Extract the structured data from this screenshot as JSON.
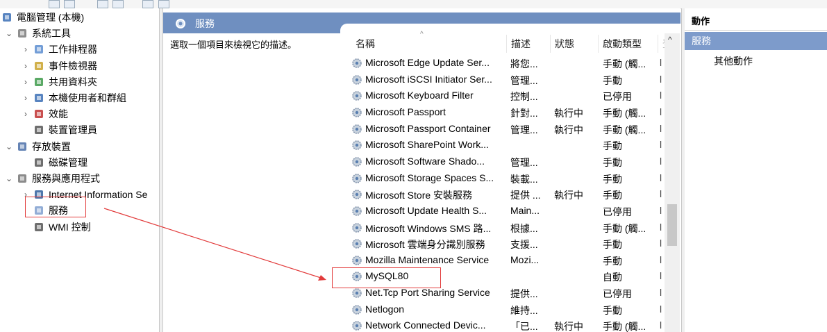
{
  "app": {
    "title": "電腦管理 (本機)"
  },
  "tree": {
    "items": [
      {
        "label": "電腦管理 (本機)",
        "indent": 0,
        "chevron": "",
        "icon": "computer-icon"
      },
      {
        "label": "系統工具",
        "indent": 1,
        "chevron": "⌄",
        "icon": "tools-icon"
      },
      {
        "label": "工作排程器",
        "indent": 2,
        "chevron": "›",
        "icon": "clock-icon"
      },
      {
        "label": "事件檢視器",
        "indent": 2,
        "chevron": "›",
        "icon": "event-viewer-icon"
      },
      {
        "label": "共用資料夾",
        "indent": 2,
        "chevron": "›",
        "icon": "shared-folder-icon"
      },
      {
        "label": "本機使用者和群組",
        "indent": 2,
        "chevron": "›",
        "icon": "users-icon"
      },
      {
        "label": "效能",
        "indent": 2,
        "chevron": "›",
        "icon": "performance-icon"
      },
      {
        "label": "裝置管理員",
        "indent": 2,
        "chevron": "",
        "icon": "device-manager-icon"
      },
      {
        "label": "存放裝置",
        "indent": 1,
        "chevron": "⌄",
        "icon": "storage-icon"
      },
      {
        "label": "磁碟管理",
        "indent": 2,
        "chevron": "",
        "icon": "disk-icon"
      },
      {
        "label": "服務與應用程式",
        "indent": 1,
        "chevron": "⌄",
        "icon": "services-apps-icon"
      },
      {
        "label": "Internet Information Se",
        "indent": 2,
        "chevron": "›",
        "icon": "iis-icon"
      },
      {
        "label": "服務",
        "indent": 2,
        "chevron": "",
        "icon": "gear-icon"
      },
      {
        "label": "WMI 控制",
        "indent": 2,
        "chevron": "",
        "icon": "wmi-icon"
      }
    ]
  },
  "center": {
    "header_label": "服務",
    "description": "選取一個項目來檢視它的描述。",
    "columns": [
      "名稱",
      "描述",
      "狀態",
      "啟動類型",
      "登"
    ],
    "rows": [
      {
        "name": "Microsoft Edge Update Ser...",
        "desc": "將您...",
        "status": "",
        "startup": "手動 (觸...",
        "logon": "l"
      },
      {
        "name": "Microsoft iSCSI Initiator Ser...",
        "desc": "管理...",
        "status": "",
        "startup": "手動",
        "logon": "l"
      },
      {
        "name": "Microsoft Keyboard Filter",
        "desc": "控制...",
        "status": "",
        "startup": "已停用",
        "logon": "l"
      },
      {
        "name": "Microsoft Passport",
        "desc": "針對...",
        "status": "執行中",
        "startup": "手動 (觸...",
        "logon": "l"
      },
      {
        "name": "Microsoft Passport Container",
        "desc": "管理...",
        "status": "執行中",
        "startup": "手動 (觸...",
        "logon": "l"
      },
      {
        "name": "Microsoft SharePoint Work...",
        "desc": "",
        "status": "",
        "startup": "手動",
        "logon": "l"
      },
      {
        "name": "Microsoft Software Shado...",
        "desc": "管理...",
        "status": "",
        "startup": "手動",
        "logon": "l"
      },
      {
        "name": "Microsoft Storage Spaces S...",
        "desc": "裝載...",
        "status": "",
        "startup": "手動",
        "logon": "l"
      },
      {
        "name": "Microsoft Store 安裝服務",
        "desc": "提供 ...",
        "status": "執行中",
        "startup": "手動",
        "logon": "l"
      },
      {
        "name": "Microsoft Update Health S...",
        "desc": "Main...",
        "status": "",
        "startup": "已停用",
        "logon": "l"
      },
      {
        "name": "Microsoft Windows SMS 路...",
        "desc": "根據...",
        "status": "",
        "startup": "手動 (觸...",
        "logon": "l"
      },
      {
        "name": "Microsoft 雲端身分識別服務",
        "desc": "支援...",
        "status": "",
        "startup": "手動",
        "logon": "l"
      },
      {
        "name": "Mozilla Maintenance Service",
        "desc": "Mozi...",
        "status": "",
        "startup": "手動",
        "logon": "l"
      },
      {
        "name": "MySQL80",
        "desc": "",
        "status": "",
        "startup": "自動",
        "logon": "l"
      },
      {
        "name": "Net.Tcp Port Sharing Service",
        "desc": "提供...",
        "status": "",
        "startup": "已停用",
        "logon": "l"
      },
      {
        "name": "Netlogon",
        "desc": "維持...",
        "status": "",
        "startup": "手動",
        "logon": "l"
      },
      {
        "name": "Network Connected Devic...",
        "desc": "「已...",
        "status": "執行中",
        "startup": "手動 (觸...",
        "logon": "l"
      }
    ]
  },
  "actions": {
    "header": "動作",
    "selected": "服務",
    "more": "其他動作"
  },
  "colors": {
    "header_blue": "#6f8fc0",
    "selected_blue": "#7d9bcb",
    "annotation_red": "#e23b3b"
  }
}
